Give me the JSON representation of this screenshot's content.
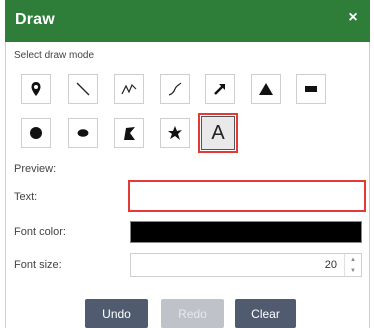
{
  "window": {
    "title": "Draw",
    "close_glyph": "×"
  },
  "draw_mode": {
    "label": "Select draw mode",
    "tools": [
      {
        "name": "point",
        "icon": "pin-icon"
      },
      {
        "name": "line",
        "icon": "line-icon"
      },
      {
        "name": "polyline",
        "icon": "polyline-icon"
      },
      {
        "name": "freehand-polyline",
        "icon": "freehand-line-icon"
      },
      {
        "name": "arrow",
        "icon": "arrow-icon"
      },
      {
        "name": "triangle",
        "icon": "triangle-icon"
      },
      {
        "name": "rectangle",
        "icon": "rectangle-icon"
      },
      {
        "name": "circle",
        "icon": "circle-icon"
      },
      {
        "name": "ellipse",
        "icon": "ellipse-icon"
      },
      {
        "name": "polygon",
        "icon": "polygon-icon"
      },
      {
        "name": "freehand-polygon",
        "icon": "freehand-polygon-icon"
      },
      {
        "name": "text",
        "icon": "text-icon",
        "glyph": "A",
        "selected": true
      }
    ]
  },
  "preview": {
    "label": "Preview:"
  },
  "text_field": {
    "label": "Text:",
    "value": ""
  },
  "font_color": {
    "label": "Font color:",
    "value": "#000000"
  },
  "font_size": {
    "label": "Font size:",
    "value": "20"
  },
  "buttons": {
    "undo": "Undo",
    "redo": "Redo",
    "clear": "Clear"
  },
  "colors": {
    "header": "#2e7d39",
    "button": "#505b70",
    "button_disabled": "#bfc3c9",
    "highlight": "#e53935"
  }
}
